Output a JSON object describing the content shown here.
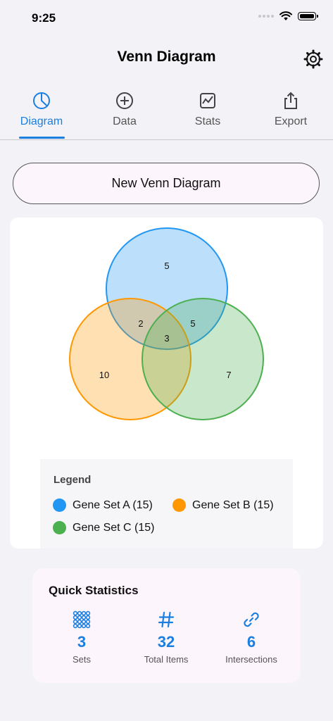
{
  "status_bar": {
    "time": "9:25"
  },
  "nav": {
    "title": "Venn Diagram"
  },
  "tabs": [
    {
      "label": "Diagram",
      "icon": "pie-chart-icon",
      "active": true
    },
    {
      "label": "Data",
      "icon": "plus-circle-icon",
      "active": false
    },
    {
      "label": "Stats",
      "icon": "line-chart-icon",
      "active": false
    },
    {
      "label": "Export",
      "icon": "share-icon",
      "active": false
    }
  ],
  "new_button": {
    "label": "New Venn Diagram"
  },
  "venn": {
    "sets": [
      {
        "name": "Gene Set A (15)",
        "color": "#2196f3"
      },
      {
        "name": "Gene Set B (15)",
        "color": "#ff9800"
      },
      {
        "name": "Gene Set C (15)",
        "color": "#4caf50"
      }
    ],
    "regions": {
      "a_only": "5",
      "b_only": "10",
      "c_only": "7",
      "ab": "2",
      "ac": "5",
      "bc": "",
      "abc": "3"
    }
  },
  "legend": {
    "title": "Legend",
    "items": [
      {
        "label": "Gene Set A (15)",
        "color": "#2196f3"
      },
      {
        "label": "Gene Set B (15)",
        "color": "#ff9800"
      },
      {
        "label": "Gene Set C (15)",
        "color": "#4caf50"
      }
    ]
  },
  "quick_stats": {
    "title": "Quick Statistics",
    "items": [
      {
        "value": "3",
        "label": "Sets",
        "icon": "grid-dots-icon"
      },
      {
        "value": "32",
        "label": "Total Items",
        "icon": "hash-icon"
      },
      {
        "value": "6",
        "label": "Intersections",
        "icon": "link-icon"
      }
    ],
    "accent": "#1a7fe0"
  }
}
